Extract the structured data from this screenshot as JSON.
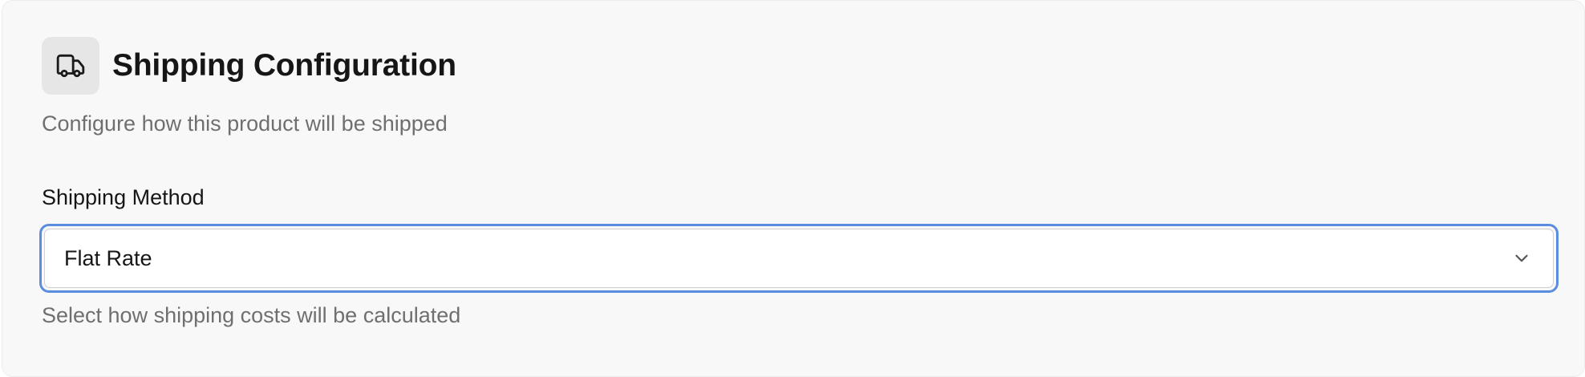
{
  "section": {
    "icon": "truck-icon",
    "title": "Shipping Configuration",
    "subtitle": "Configure how this product will be shipped"
  },
  "shipping_method": {
    "label": "Shipping Method",
    "selected_value": "Flat Rate",
    "help_text": "Select how shipping costs will be calculated",
    "focused": true
  },
  "colors": {
    "focus_ring": "#5a8de0",
    "panel_background": "#f8f8f8",
    "muted_text": "#6f6f6f"
  }
}
